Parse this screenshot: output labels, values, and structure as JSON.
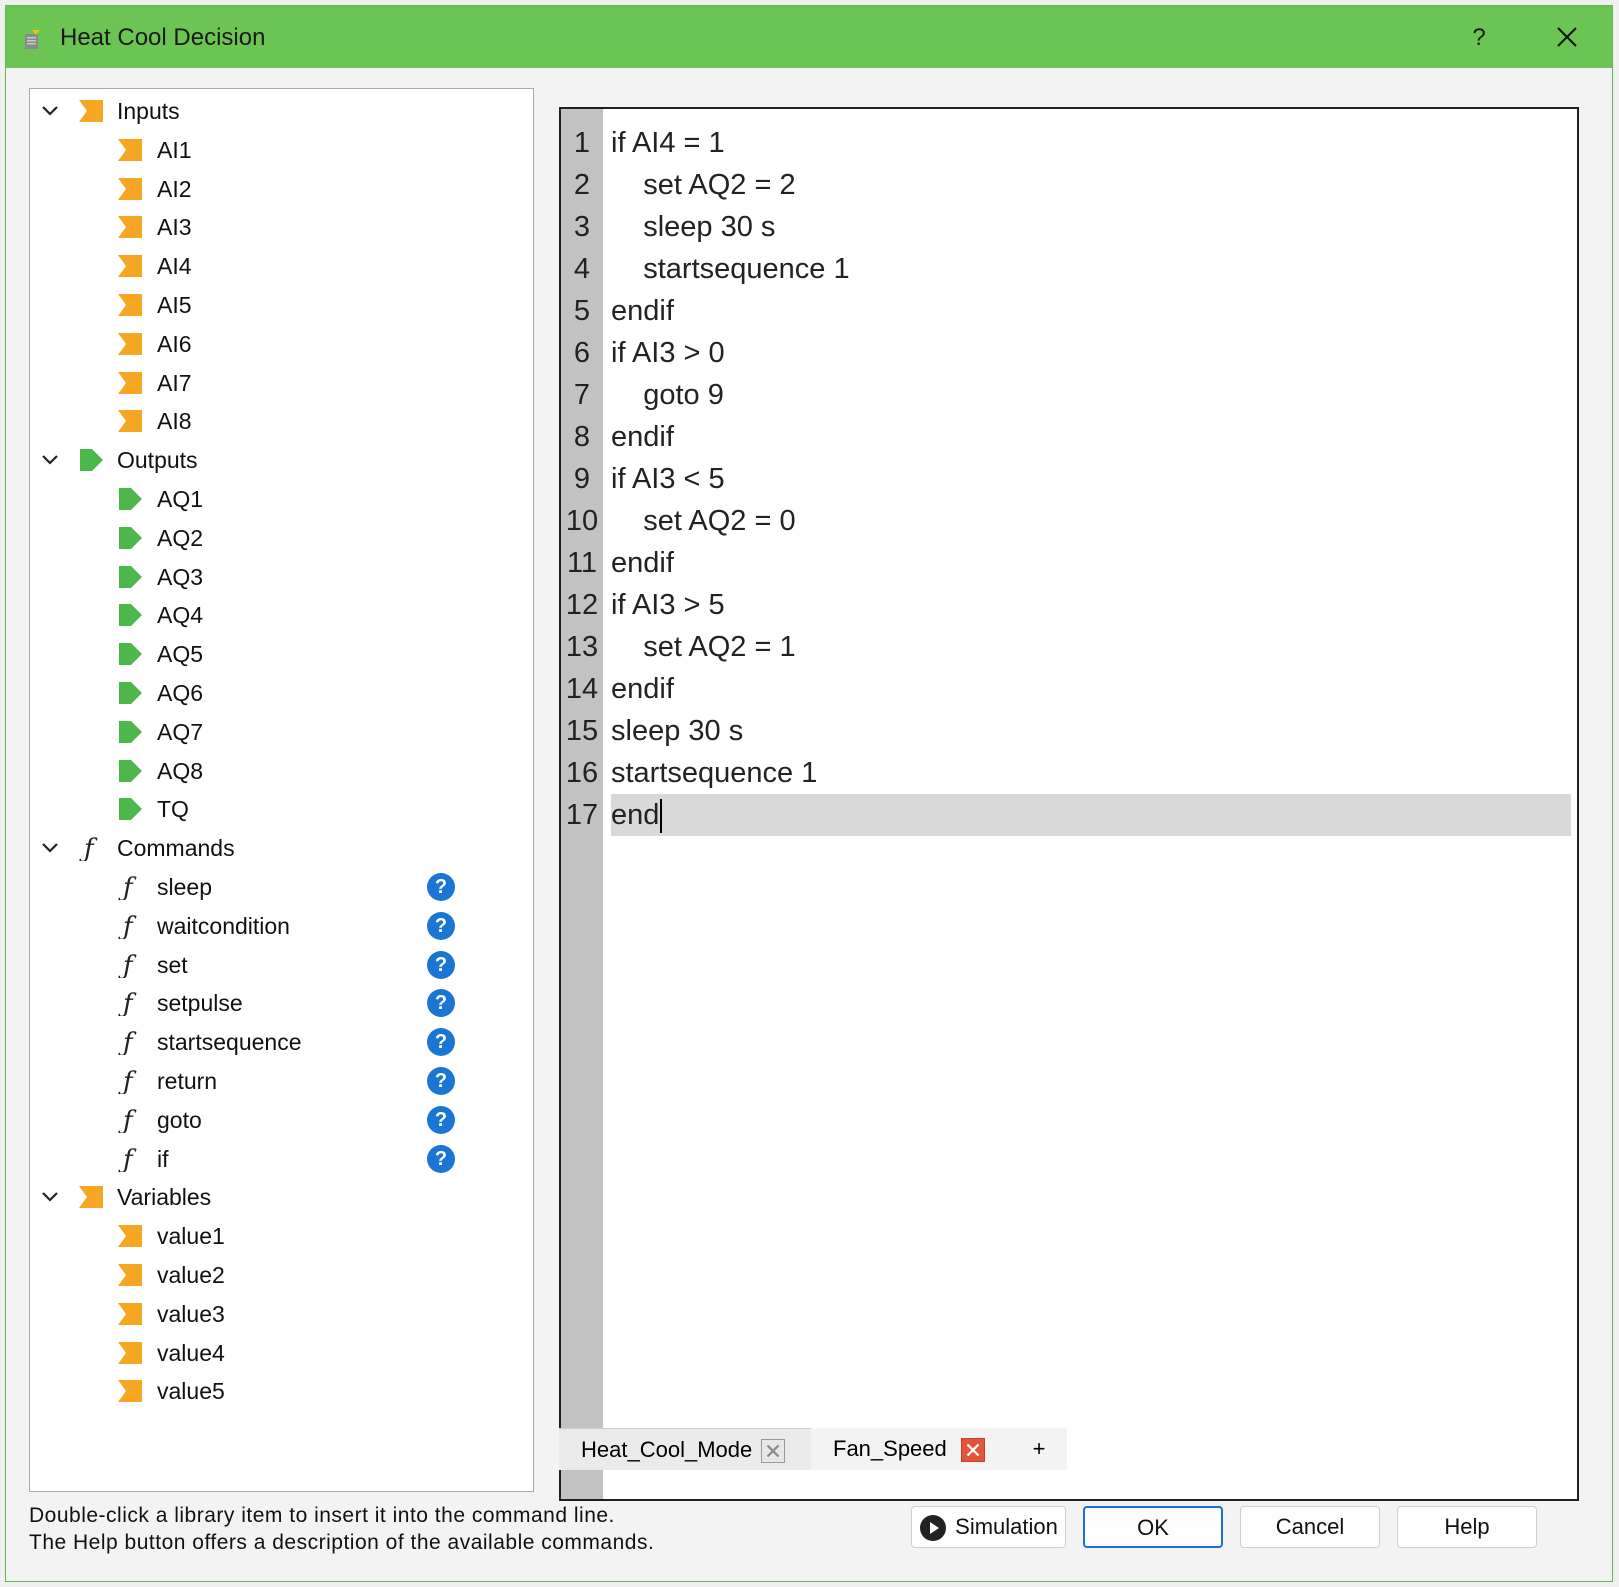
{
  "window": {
    "title": "Heat Cool Decision",
    "help_label": "?"
  },
  "tree": {
    "groups": [
      {
        "label": "Inputs",
        "icon": "orange-bookmark-icon",
        "items": [
          "AI1",
          "AI2",
          "AI3",
          "AI4",
          "AI5",
          "AI6",
          "AI7",
          "AI8"
        ]
      },
      {
        "label": "Outputs",
        "icon": "green-tag-icon",
        "items": [
          "AQ1",
          "AQ2",
          "AQ3",
          "AQ4",
          "AQ5",
          "AQ6",
          "AQ7",
          "AQ8",
          "TQ"
        ]
      },
      {
        "label": "Commands",
        "icon": "function-icon",
        "items": [
          "sleep",
          "waitcondition",
          "set",
          "setpulse",
          "startsequence",
          "return",
          "goto",
          "if"
        ]
      },
      {
        "label": "Variables",
        "icon": "orange-bookmark-icon",
        "items": [
          "value1",
          "value2",
          "value3",
          "value4",
          "value5"
        ]
      }
    ],
    "help_glyph": "?"
  },
  "editor": {
    "lines": [
      "if AI4 = 1",
      "    set AQ2 = 2",
      "    sleep 30 s",
      "    startsequence 1",
      "endif",
      "if AI3 > 0",
      "    goto 9",
      "endif",
      "if AI3 < 5",
      "    set AQ2 = 0",
      "endif",
      "if AI3 > 5",
      "    set AQ2 = 1",
      "endif",
      "sleep 30 s",
      "startsequence 1",
      "end"
    ],
    "current_line": 17
  },
  "tabs": [
    {
      "label": "Heat_Cool_Mode",
      "active": false
    },
    {
      "label": "Fan_Speed",
      "active": true
    }
  ],
  "add_tab_label": "+",
  "hint": {
    "line1": "Double-click a library item to insert it into the command line.",
    "line2": "The Help button offers a description of the available commands."
  },
  "buttons": {
    "simulation": "Simulation",
    "ok": "OK",
    "cancel": "Cancel",
    "help": "Help"
  },
  "colors": {
    "titlebar": "#6cc452",
    "input_icon": "#f5a623",
    "output_icon": "#4cb84a",
    "help_blue": "#1976d2",
    "tab_close_active": "#e2553a"
  }
}
